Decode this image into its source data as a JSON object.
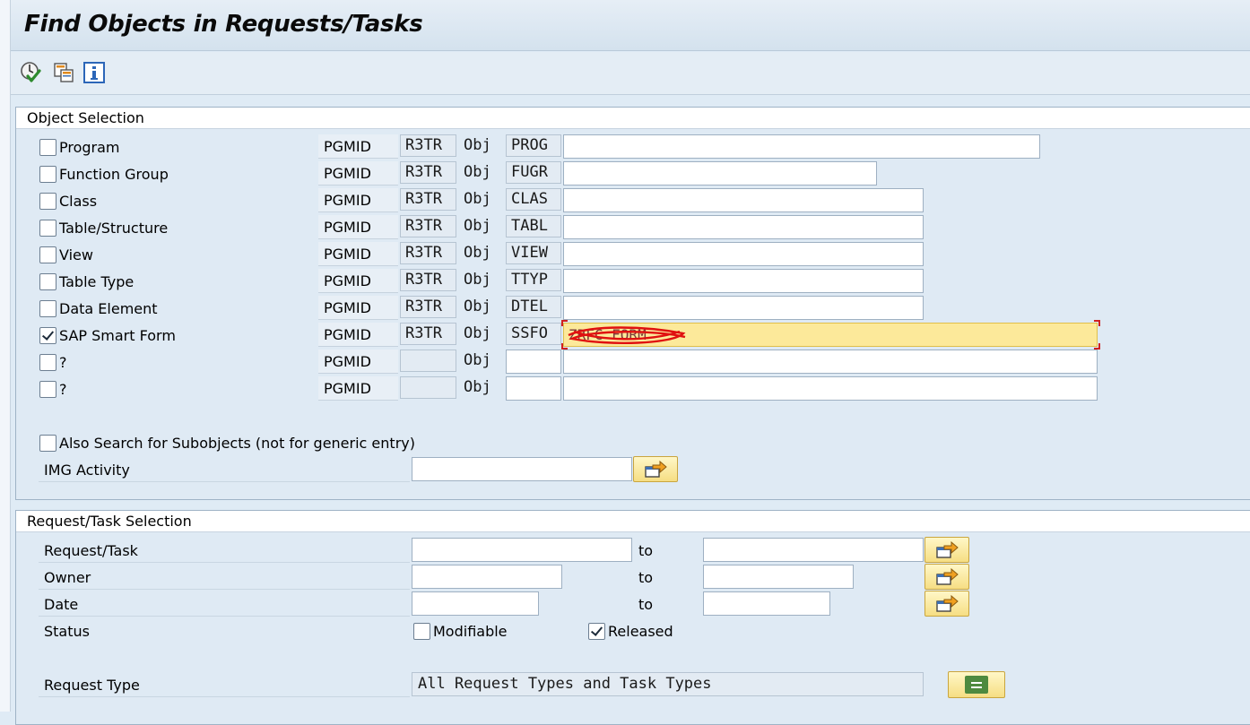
{
  "window": {
    "title": "Find Objects in Requests/Tasks"
  },
  "toolbar": {
    "icons": [
      "execute-icon",
      "copy-selection-icon",
      "info-icon"
    ]
  },
  "object_selection": {
    "header": "Object Selection",
    "pgmid_label": "PGMID",
    "obj_label": "Obj",
    "rows": [
      {
        "label": "Program",
        "checked": false,
        "pgmid": "R3TR",
        "type": "PROG",
        "value": ""
      },
      {
        "label": "Function Group",
        "checked": false,
        "pgmid": "R3TR",
        "type": "FUGR",
        "value": ""
      },
      {
        "label": "Class",
        "checked": false,
        "pgmid": "R3TR",
        "type": "CLAS",
        "value": ""
      },
      {
        "label": "Table/Structure",
        "checked": false,
        "pgmid": "R3TR",
        "type": "TABL",
        "value": ""
      },
      {
        "label": "View",
        "checked": false,
        "pgmid": "R3TR",
        "type": "VIEW",
        "value": ""
      },
      {
        "label": "Table Type",
        "checked": false,
        "pgmid": "R3TR",
        "type": "TTYP",
        "value": ""
      },
      {
        "label": "Data Element",
        "checked": false,
        "pgmid": "R3TR",
        "type": "DTEL",
        "value": ""
      },
      {
        "label": "SAP Smart Form",
        "checked": true,
        "pgmid": "R3TR",
        "type": "SSFO",
        "value": "ZRFC_FORM"
      },
      {
        "label": "?",
        "checked": false,
        "pgmid": "",
        "type": "",
        "value": ""
      },
      {
        "label": "?",
        "checked": false,
        "pgmid": "",
        "type": "",
        "value": ""
      }
    ],
    "subobjects_label": "Also Search for Subobjects (not for generic entry)",
    "subobjects_checked": false,
    "img_activity_label": "IMG Activity",
    "img_activity_value": ""
  },
  "request_selection": {
    "header": "Request/Task Selection",
    "to_label": "to",
    "request_task": {
      "label": "Request/Task",
      "from": "",
      "to": ""
    },
    "owner": {
      "label": "Owner",
      "from": "",
      "to": ""
    },
    "date": {
      "label": "Date",
      "from": "",
      "to": ""
    },
    "status": {
      "label": "Status",
      "modifiable_label": "Modifiable",
      "modifiable_checked": false,
      "released_label": "Released",
      "released_checked": true
    },
    "request_type": {
      "label": "Request Type",
      "value": "All Request Types and Task Types"
    }
  }
}
